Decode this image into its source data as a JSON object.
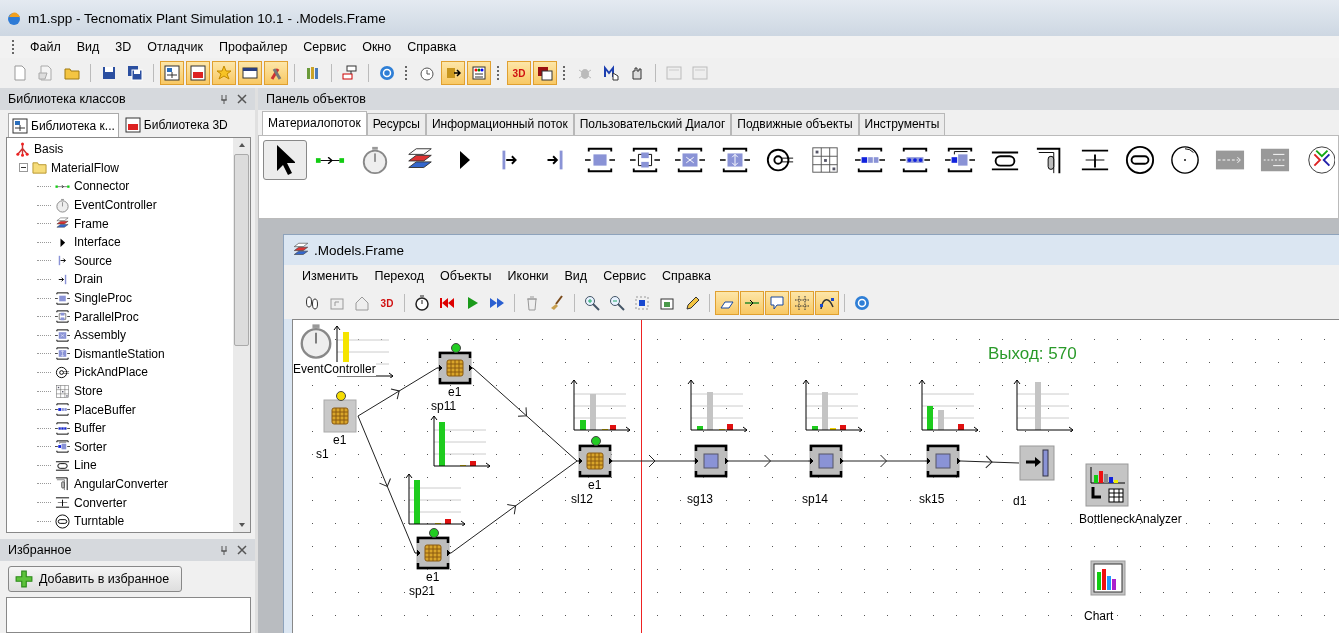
{
  "window": {
    "title": "m1.spp - Tecnomatix Plant Simulation 10.1 - .Models.Frame"
  },
  "menu": [
    "Файл",
    "Вид",
    "3D",
    "Отладчик",
    "Профайлер",
    "Сервис",
    "Окно",
    "Справка"
  ],
  "toolbar": [
    {
      "on": false
    },
    {
      "on": false
    },
    {
      "on": false
    },
    {
      "on": false
    },
    {
      "on": false
    },
    {
      "on": true
    },
    {
      "on": true
    },
    {
      "on": true
    },
    {
      "on": true
    },
    {
      "on": true
    },
    {
      "on": false
    },
    {
      "on": false
    },
    {
      "on": false
    },
    {
      "on": false
    },
    {
      "on": true
    },
    {
      "on": true
    },
    {
      "on": true,
      "label": "3D"
    },
    {
      "on": true
    },
    {
      "on": false
    },
    {
      "on": false
    },
    {
      "on": false
    },
    {
      "on": false
    },
    {
      "on": false
    }
  ],
  "class_library": {
    "title": "Библиотека классов",
    "tabs": [
      {
        "label": "Библиотека к...",
        "selected": true
      },
      {
        "label": "Библиотека 3D",
        "selected": false
      }
    ],
    "tree": [
      {
        "label": "Basis",
        "children": [
          {
            "label": "MaterialFlow",
            "children": [
              {
                "label": "Connector"
              },
              {
                "label": "EventController"
              },
              {
                "label": "Frame"
              },
              {
                "label": "Interface"
              },
              {
                "label": "Source"
              },
              {
                "label": "Drain"
              },
              {
                "label": "SingleProc"
              },
              {
                "label": "ParallelProc"
              },
              {
                "label": "Assembly"
              },
              {
                "label": "DismantleStation"
              },
              {
                "label": "PickAndPlace"
              },
              {
                "label": "Store"
              },
              {
                "label": "PlaceBuffer"
              },
              {
                "label": "Buffer"
              },
              {
                "label": "Sorter"
              },
              {
                "label": "Line"
              },
              {
                "label": "AngularConverter"
              },
              {
                "label": "Converter"
              },
              {
                "label": "Turntable"
              }
            ]
          }
        ]
      }
    ]
  },
  "favorites": {
    "title": "Избранное",
    "button": "Добавить в избранное"
  },
  "object_panel": {
    "title": "Панель объектов",
    "tabs": [
      {
        "label": "Материалопоток",
        "selected": true
      },
      {
        "label": "Ресурсы",
        "selected": false
      },
      {
        "label": "Информационный поток",
        "selected": false
      },
      {
        "label": "Пользовательский Диалог",
        "selected": false
      },
      {
        "label": "Подвижные объекты",
        "selected": false
      },
      {
        "label": "Инструменты",
        "selected": false
      }
    ],
    "tools": [
      {
        "selected": true
      },
      {
        "selected": false
      },
      {
        "selected": false
      },
      {
        "selected": false
      },
      {
        "selected": false
      },
      {
        "selected": false
      },
      {
        "selected": false
      },
      {
        "selected": false
      },
      {
        "selected": false
      },
      {
        "selected": false
      },
      {
        "selected": false
      },
      {
        "selected": false
      },
      {
        "selected": false
      },
      {
        "selected": false
      },
      {
        "selected": false
      },
      {
        "selected": false
      },
      {
        "selected": false
      },
      {
        "selected": false
      },
      {
        "selected": false
      },
      {
        "selected": false
      },
      {
        "selected": false
      },
      {
        "selected": false
      },
      {
        "selected": false
      },
      {
        "selected": false
      }
    ]
  },
  "frame": {
    "title": ".Models.Frame",
    "menu": [
      "Изменить",
      "Переход",
      "Объекты",
      "Иконки",
      "Вид",
      "Сервис",
      "Справка"
    ],
    "toolbar": [
      {
        "on": false
      },
      {
        "on": false
      },
      {
        "on": false
      },
      {
        "on": false,
        "label": "3D"
      },
      {
        "on": false
      },
      {
        "on": false
      },
      {
        "on": false
      },
      {
        "on": false
      },
      {
        "on": false
      },
      {
        "on": false
      },
      {
        "on": false
      },
      {
        "on": false
      },
      {
        "on": false
      },
      {
        "on": false
      },
      {
        "on": false
      },
      {
        "on": true
      },
      {
        "on": true
      },
      {
        "on": true
      },
      {
        "on": true
      },
      {
        "on": true
      },
      {
        "on": false
      }
    ],
    "output": "Выход: 570",
    "nodes": [
      {
        "kind": "event_controller",
        "name": "EventController"
      },
      {
        "kind": "source",
        "name": "s1",
        "part": "e1",
        "color": "#f5dc00"
      },
      {
        "kind": "station",
        "name": "sp11",
        "part": "e1",
        "color": "#22cc22"
      },
      {
        "kind": "station",
        "name": "sp21",
        "part": "e1",
        "color": "#22cc22"
      },
      {
        "kind": "station",
        "name": "sl12",
        "part": "e1",
        "color": "#22cc22"
      },
      {
        "kind": "station",
        "name": "sg13"
      },
      {
        "kind": "station",
        "name": "sp14"
      },
      {
        "kind": "station",
        "name": "sk15"
      },
      {
        "kind": "drain",
        "name": "d1"
      },
      {
        "kind": "analyzer",
        "name": "BottleneckAnalyzer"
      },
      {
        "kind": "chart",
        "name": "Chart"
      }
    ]
  }
}
